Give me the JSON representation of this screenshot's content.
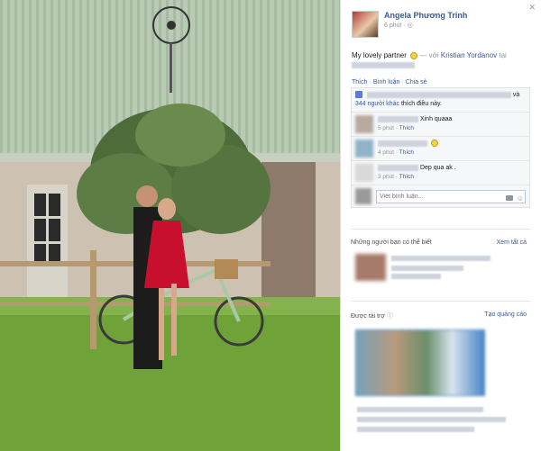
{
  "author": {
    "name": "Angela Phương Trinh",
    "time": "6 phút"
  },
  "post": {
    "caption": "My lovely partner",
    "with_text": "— với",
    "partner": "Kristian Yordanov",
    "at_text": "tại"
  },
  "actions": {
    "like": "Thích",
    "comment": "Bình luận",
    "share": "Chia sẻ"
  },
  "likes": {
    "text_suffix": "và",
    "others": "344 người khác",
    "likes_this": "thích điều này."
  },
  "comments": [
    {
      "text": "Xinh quaaa",
      "time": "5 phút",
      "like": "Thích"
    },
    {
      "text": "",
      "time": "4 phút",
      "like": "Thích"
    },
    {
      "text": "Dep qua ak .",
      "time": "3 phút",
      "like": "Thích"
    }
  ],
  "comment_input": {
    "placeholder": "Viết bình luận..."
  },
  "suggestions": {
    "title": "Những người bạn có thể biết",
    "see_all": "Xem tất cả"
  },
  "ads": {
    "title": "Được tài trợ",
    "create": "Tạo quảng cáo"
  },
  "icons": {
    "close": "close-icon",
    "like": "thumbs-up-icon",
    "camera": "camera-icon",
    "smile": "smile-emoji-icon",
    "globe": "globe-icon"
  },
  "colors": {
    "link": "#3b5998",
    "muted": "#90949c"
  }
}
